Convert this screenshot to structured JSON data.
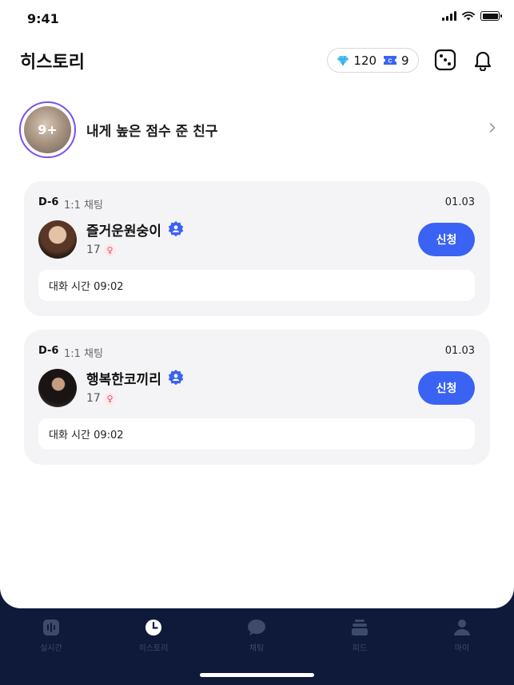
{
  "status_bar": {
    "time": "9:41"
  },
  "header": {
    "title": "히스토리",
    "gems": "120",
    "tickets": "9"
  },
  "top_friends": {
    "badge": "9+",
    "label": "내게 높은 점수 준 친구"
  },
  "history": [
    {
      "dday": "D-6",
      "type": "1:1 채팅",
      "date": "01.03",
      "name": "즐거운원숭이",
      "age": "17",
      "gender_symbol": "♀",
      "action": "신청",
      "chat_time": "대화 시간 09:02"
    },
    {
      "dday": "D-6",
      "type": "1:1 채팅",
      "date": "01.03",
      "name": "행복한코끼리",
      "age": "17",
      "gender_symbol": "♀",
      "action": "신청",
      "chat_time": "대화 시간 09:02"
    }
  ],
  "tabs": [
    {
      "label": "실시간",
      "icon": "live-icon",
      "active": false
    },
    {
      "label": "히스토리",
      "icon": "clock-icon",
      "active": true
    },
    {
      "label": "채팅",
      "icon": "chat-icon",
      "active": false
    },
    {
      "label": "피드",
      "icon": "feed-icon",
      "active": false
    },
    {
      "label": "마이",
      "icon": "person-icon",
      "active": false
    }
  ],
  "colors": {
    "accent": "#3a63f3",
    "ring": "#7a4ff0",
    "tabbar": "#0f1a3a",
    "card_bg": "#f4f4f6",
    "verified": "#3a63f3",
    "gender_female": "#e8506a"
  }
}
